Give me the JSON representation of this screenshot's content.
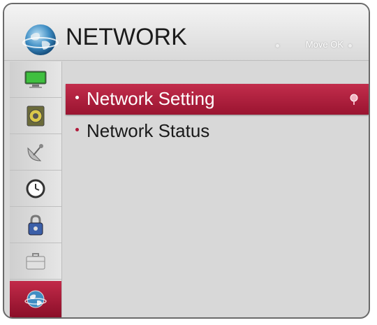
{
  "header": {
    "title": "NETWORK",
    "hint": "Move OK",
    "icon": "globe-icon"
  },
  "sidebar": {
    "items": [
      {
        "name": "picture",
        "icon": "monitor-icon"
      },
      {
        "name": "audio",
        "icon": "speaker-icon"
      },
      {
        "name": "channel",
        "icon": "satellite-dish-icon"
      },
      {
        "name": "time",
        "icon": "clock-icon"
      },
      {
        "name": "lock",
        "icon": "padlock-icon"
      },
      {
        "name": "option",
        "icon": "toolbox-icon"
      },
      {
        "name": "network",
        "icon": "globe-icon",
        "active": true
      }
    ]
  },
  "menu": {
    "items": [
      {
        "label": "Network Setting",
        "selected": true
      },
      {
        "label": "Network Status",
        "selected": false
      }
    ]
  },
  "colors": {
    "accent": "#b01a3a",
    "panel": "#d8d8d8",
    "header_text": "#1b1b1b"
  }
}
